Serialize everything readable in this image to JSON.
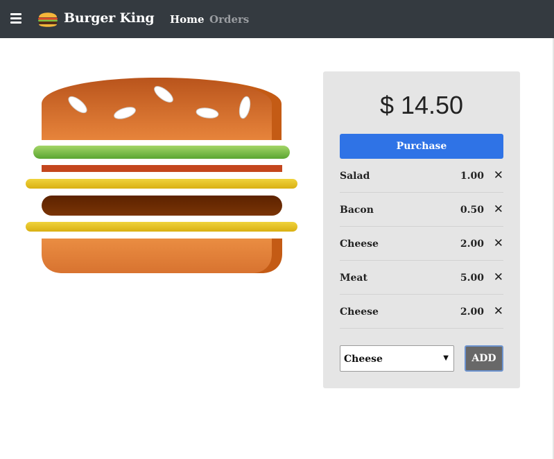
{
  "navbar": {
    "menu_icon": "hamburger-menu-icon",
    "logo_icon": "burger-logo-icon",
    "brand": "Burger King",
    "links": [
      {
        "label": "Home",
        "active": true
      },
      {
        "label": "Orders",
        "active": false
      }
    ],
    "background": "#343a40"
  },
  "burger": {
    "layers": [
      "bun-top",
      "salad",
      "bacon",
      "cheese",
      "meat",
      "cheese",
      "bun-bottom"
    ],
    "colors": {
      "bun": "#d97a33",
      "salad": "#7cc242",
      "bacon": "#c4461d",
      "cheese": "#e9c61f",
      "meat": "#6b2a00"
    }
  },
  "order": {
    "price": "$ 14.50",
    "purchase_label": "Purchase",
    "purchase_color": "#2f73e6",
    "items": [
      {
        "name": "Salad",
        "price": "1.00"
      },
      {
        "name": "Bacon",
        "price": "0.50"
      },
      {
        "name": "Cheese",
        "price": "2.00"
      },
      {
        "name": "Meat",
        "price": "5.00"
      },
      {
        "name": "Cheese",
        "price": "2.00"
      }
    ],
    "remove_icon": "close-icon",
    "select_value": "Cheese",
    "add_label": "ADD"
  }
}
